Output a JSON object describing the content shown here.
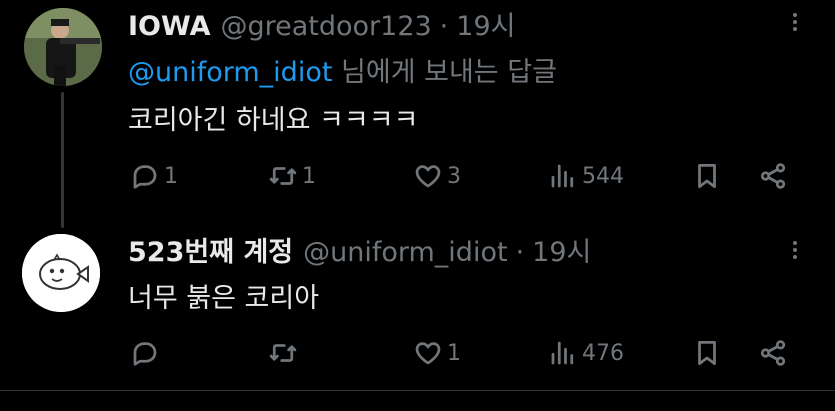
{
  "tweets": [
    {
      "name": "IOWA",
      "handle": "@greatdoor123",
      "separator": "·",
      "time": "19시",
      "reply_mention": "@uniform_idiot",
      "reply_rest": " 님에게 보내는 답글",
      "text": "코리아긴 하네요 ㅋㅋㅋㅋ",
      "stats": {
        "replies": "1",
        "retweets": "1",
        "likes": "3",
        "views": "544"
      }
    },
    {
      "name": "523번째 계정",
      "handle": "@uniform_idiot",
      "separator": "·",
      "time": "19시",
      "text": "너무 붉은 코리아",
      "stats": {
        "replies": "",
        "retweets": "",
        "likes": "1",
        "views": "476"
      }
    }
  ],
  "colors": {
    "background": "#000000",
    "text": "#e7e9ea",
    "muted": "#71767b",
    "link": "#1d9bf0"
  },
  "icons": [
    "reply-icon",
    "retweet-icon",
    "like-icon",
    "views-icon",
    "bookmark-icon",
    "share-icon",
    "more-icon"
  ]
}
